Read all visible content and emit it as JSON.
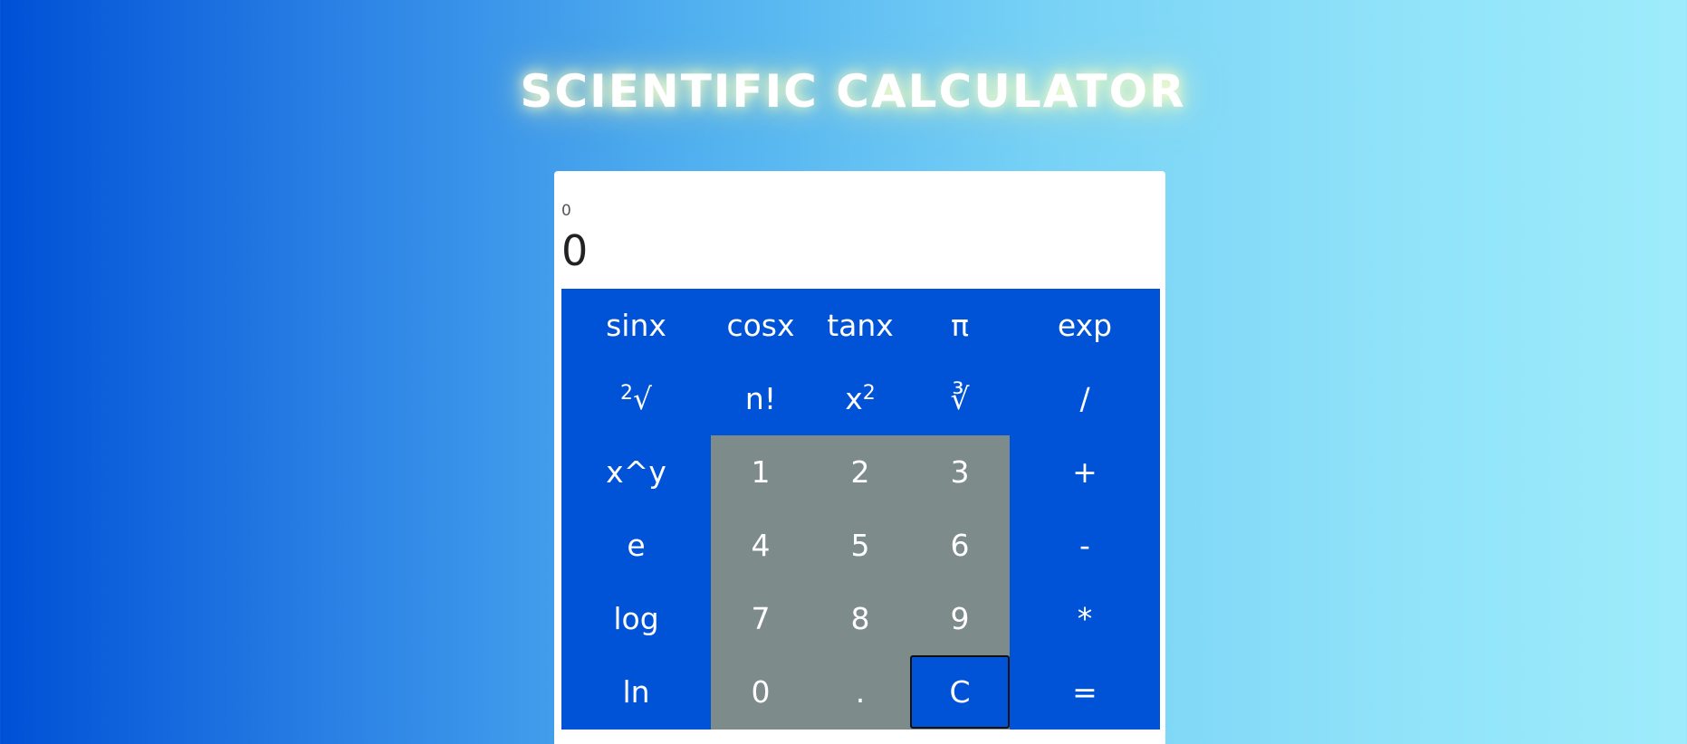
{
  "page": {
    "title": "SCIENTIFIC CALCULATOR"
  },
  "display": {
    "history": "0",
    "result": "0"
  },
  "keys": {
    "sinx": "sinx",
    "cosx": "cosx",
    "tanx": "tanx",
    "pi": "π",
    "exp": "exp",
    "sqrt_base": "√",
    "sqrt_sup": "2",
    "factorial": "n!",
    "square_base": "x",
    "square_sup": "2",
    "cbrt": "∛",
    "divide": "/",
    "power": "x^y",
    "one": "1",
    "two": "2",
    "three": "3",
    "plus": "+",
    "e": "e",
    "four": "4",
    "five": "5",
    "six": "6",
    "minus": "-",
    "log": "log",
    "seven": "7",
    "eight": "8",
    "nine": "9",
    "multiply": "*",
    "ln": "ln",
    "zero": "0",
    "dot": ".",
    "clear": "C",
    "equals": "="
  },
  "colors": {
    "keypad": "#0052d6",
    "number_keys": "#7e8b8b",
    "background_start": "#0050d6",
    "background_end": "#9eecfb"
  }
}
